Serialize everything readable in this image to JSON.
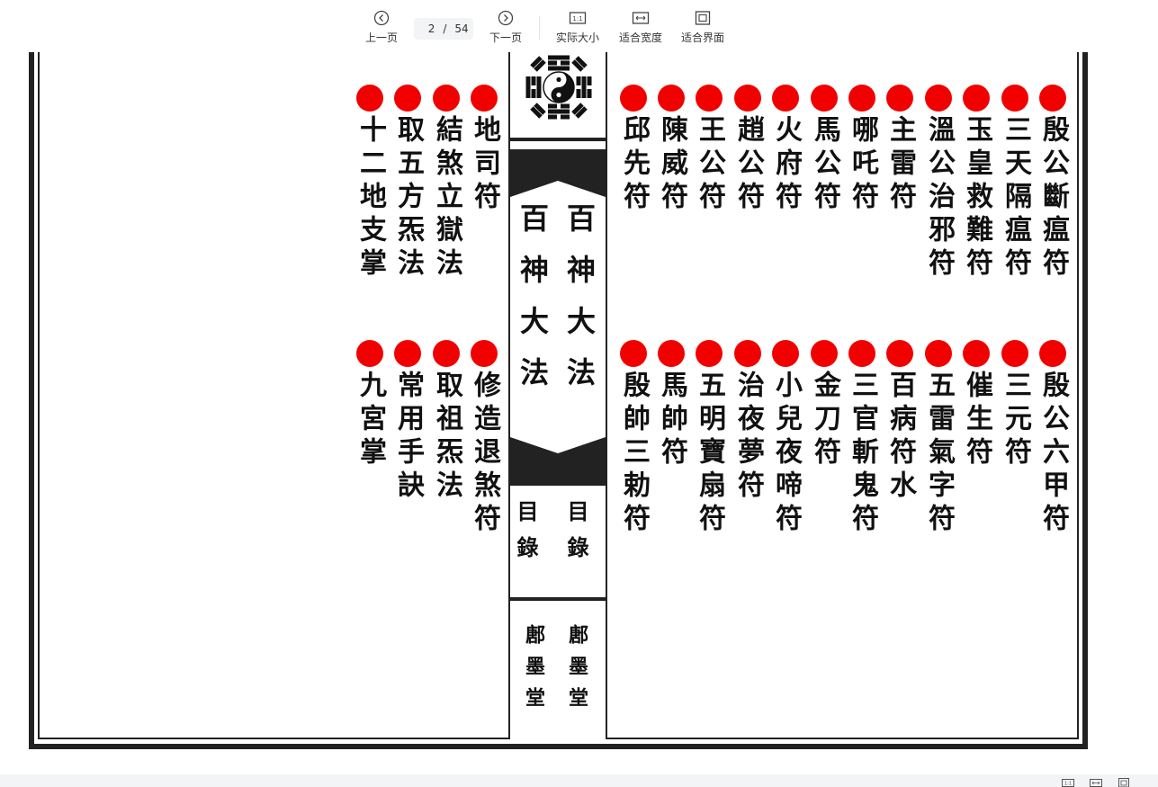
{
  "toolbar": {
    "prev_label": "上一页",
    "next_label": "下一页",
    "page_current": "2",
    "page_sep": "/",
    "page_total": "54",
    "actual_size_label": "实际大小",
    "fit_width_label": "适合宽度",
    "fit_page_label": "适合界面",
    "actual_size_glyph": "1:1"
  },
  "document": {
    "spine": {
      "title_right": "百神大法",
      "title_left": "百神大法",
      "section_right": "目錄",
      "section_left": "目錄",
      "publisher_right": "鄌墨堂",
      "publisher_left": "鄌墨堂",
      "emblem": "bagua-yin-yang-icon"
    },
    "right_page": {
      "top_row": [
        "殷公斷瘟符",
        "三天隔瘟符",
        "玉皇救難符",
        "溫公治邪符",
        "主雷符",
        "哪吒符",
        "馬公符",
        "火府符",
        "趙公符",
        "王公符",
        "陳威符",
        "邱先符"
      ],
      "bottom_row": [
        "殷公六甲符",
        "三元符",
        "催生符",
        "五雷氣字符",
        "百病符水",
        "三官斬鬼符",
        "金刀符",
        "小兒夜啼符",
        "治夜夢符",
        "五明寶扇符",
        "馬帥符",
        "殷帥三勅符"
      ]
    },
    "left_page": {
      "top_row": [
        "地司符",
        "結煞立獄法",
        "取五方炁法",
        "十二地支掌"
      ],
      "bottom_row": [
        "修造退煞符",
        "取祖炁法",
        "常用手訣",
        "九宮掌"
      ]
    },
    "bullet_color": "#f20000"
  },
  "statusbar": {
    "icons": [
      "actual-size-icon",
      "fit-width-icon",
      "fit-page-icon"
    ]
  }
}
